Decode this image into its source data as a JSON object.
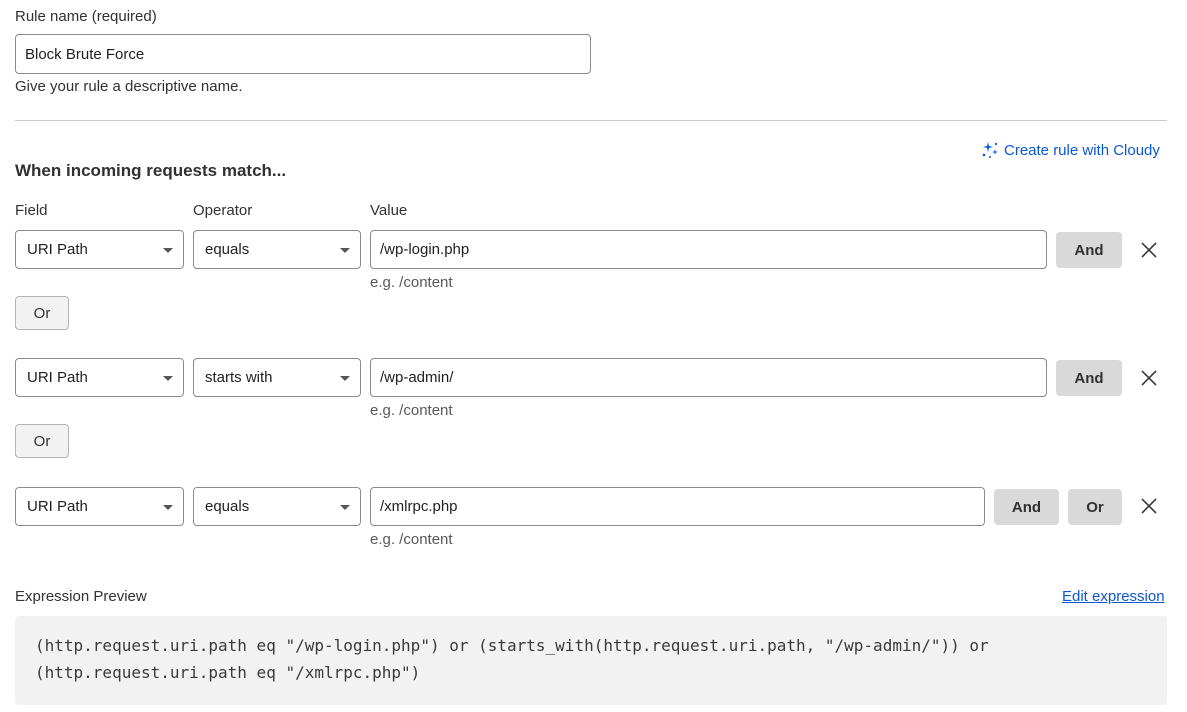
{
  "rule_name": {
    "label": "Rule name (required)",
    "value": "Block Brute Force",
    "help": "Give your rule a descriptive name."
  },
  "match": {
    "heading": "When incoming requests match...",
    "cloudy_link": "Create rule with Cloudy",
    "headers": {
      "field": "Field",
      "operator": "Operator",
      "value": "Value"
    },
    "rows": [
      {
        "field": "URI Path",
        "operator": "equals",
        "value": "/wp-login.php",
        "hint": "e.g. /content",
        "and_label": "And"
      },
      {
        "field": "URI Path",
        "operator": "starts with",
        "value": "/wp-admin/",
        "hint": "e.g. /content",
        "and_label": "And"
      },
      {
        "field": "URI Path",
        "operator": "equals",
        "value": "/xmlrpc.php",
        "hint": "e.g. /content",
        "and_label": "And",
        "or_label": "Or"
      }
    ],
    "or_buttons": [
      "Or",
      "Or"
    ]
  },
  "expression": {
    "label": "Expression Preview",
    "edit_link": "Edit expression",
    "line1": "(http.request.uri.path eq \"/wp-login.php\") or (starts_with(http.request.uri.path, \"/wp-admin/\")) or",
    "line2": "(http.request.uri.path eq \"/xmlrpc.php\")"
  },
  "icons": {
    "sparkle": "sparkle-icon",
    "close": "close-icon",
    "caret": "chevron-down-icon"
  },
  "colors": {
    "link": "#0b57d0",
    "button_gray": "#d9d9d9",
    "code_bg": "#f2f2f2"
  }
}
